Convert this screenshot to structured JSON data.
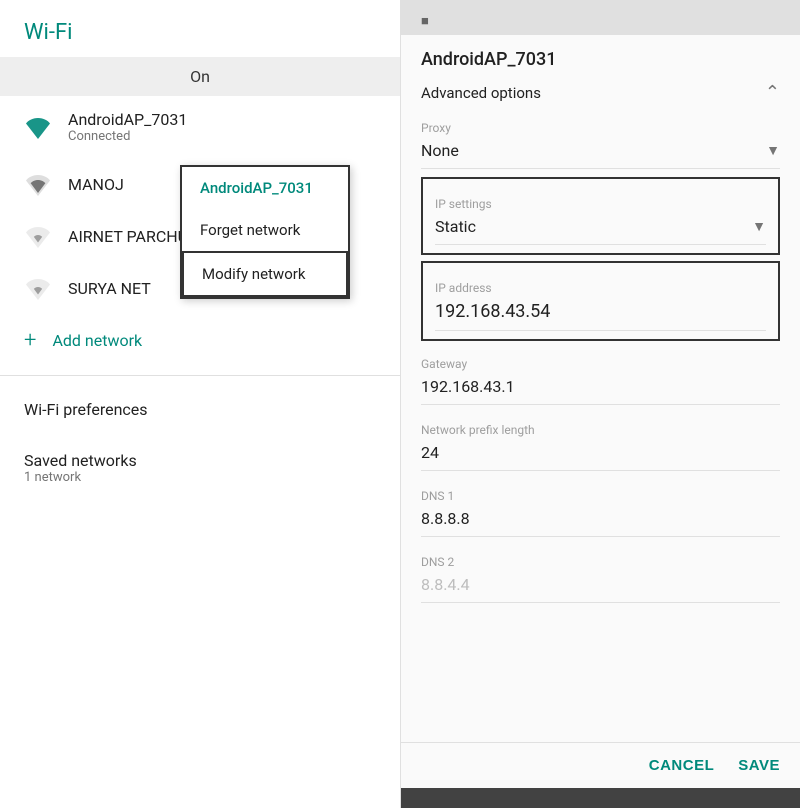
{
  "left": {
    "title": "Wi-Fi",
    "status": "On",
    "networks": [
      {
        "name": "AndroidAP_7031",
        "status": "Connected",
        "signal": 4
      },
      {
        "name": "MANOJ",
        "status": "",
        "signal": 3
      },
      {
        "name": "AIRNET PARCHURU",
        "status": "",
        "signal": 2
      },
      {
        "name": "SURYA NET",
        "status": "",
        "signal": 2
      }
    ],
    "add_network_label": "Add network",
    "context_menu": {
      "network": "AndroidAP_7031",
      "items": [
        "AndroidAP_7031",
        "Forget network",
        "Modify network"
      ]
    },
    "preferences_label": "Wi-Fi preferences",
    "saved_networks_label": "Saved networks",
    "saved_networks_sub": "1 network"
  },
  "right": {
    "network_title": "AndroidAP_7031",
    "advanced_options_label": "Advanced options",
    "proxy_label": "Proxy",
    "proxy_value": "None",
    "ip_settings_label": "IP settings",
    "ip_settings_value": "Static",
    "ip_address_label": "IP address",
    "ip_address_value": "192.168.43.54",
    "gateway_label": "Gateway",
    "gateway_value": "192.168.43.1",
    "prefix_length_label": "Network prefix length",
    "prefix_length_value": "24",
    "dns1_label": "DNS 1",
    "dns1_value": "8.8.8.8",
    "dns2_label": "DNS 2",
    "dns2_value": "8.8.4.4",
    "cancel_label": "CANCEL",
    "save_label": "SAVE"
  }
}
